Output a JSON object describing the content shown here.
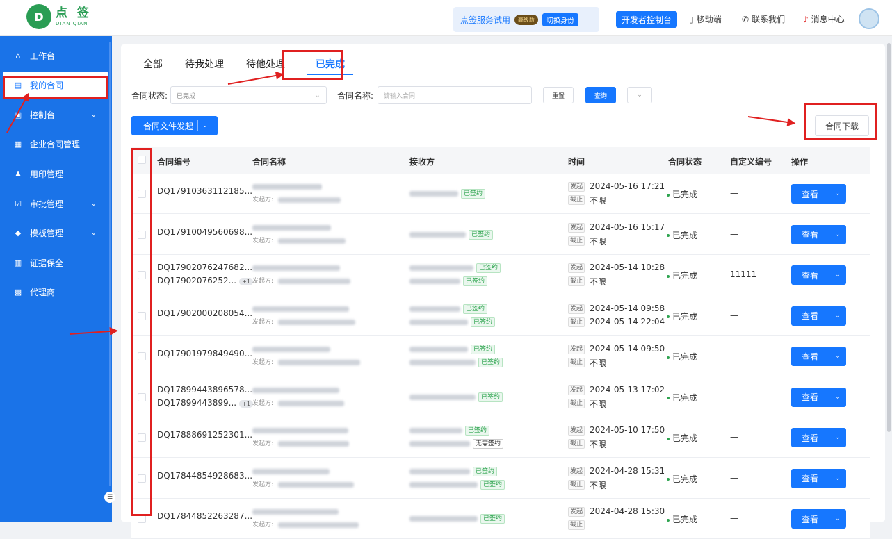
{
  "brand": {
    "cn": "点 签",
    "en": "DIAN QIAN"
  },
  "header": {
    "trial": "点签服务试用",
    "premium": "高级版",
    "switch": "切换身份",
    "dev": "开发者控制台",
    "mobile": "移动端",
    "contact": "联系我们",
    "messages": "消息中心"
  },
  "sidebar": [
    {
      "label": "工作台",
      "icon": "home-icon"
    },
    {
      "label": "我的合同",
      "icon": "contract-icon"
    },
    {
      "label": "控制台",
      "icon": "console-icon",
      "chevron": true
    },
    {
      "label": "企业合同管理",
      "icon": "enterprise-contract-icon"
    },
    {
      "label": "用印管理",
      "icon": "seal-icon"
    },
    {
      "label": "审批管理",
      "icon": "approval-icon",
      "chevron": true
    },
    {
      "label": "模板管理",
      "icon": "template-icon",
      "chevron": true
    },
    {
      "label": "证据保全",
      "icon": "evidence-icon"
    },
    {
      "label": "代理商",
      "icon": "agent-icon"
    }
  ],
  "tabs": [
    "全部",
    "待我处理",
    "待他处理",
    "已完成"
  ],
  "filters": {
    "status_label": "合同状态:",
    "status_value": "已完成",
    "name_label": "合同名称:",
    "name_placeholder": "请输入合同",
    "reset": "重置",
    "query": "查询",
    "expand": "»"
  },
  "actions": {
    "initiate": "合同文件发起",
    "download": "合同下载"
  },
  "table": {
    "headers": [
      "合同编号",
      "合同名称",
      "接收方",
      "时间",
      "合同状态",
      "自定义编号",
      "操作"
    ],
    "start_label": "发起",
    "end_label": "截止",
    "initiator_label": "发起方:",
    "signed": "已签约",
    "nosign": "无需签约",
    "view": "查看",
    "rows": [
      {
        "no": "DQ17910363112185...",
        "start": "2024-05-16 17:21",
        "end": "不限",
        "status": "已完成",
        "custom": "—"
      },
      {
        "no": "DQ17910049560698...",
        "start": "2024-05-16 15:17",
        "end": "不限",
        "status": "已完成",
        "custom": "—"
      },
      {
        "no": "DQ17902076247682...",
        "no2": "DQ17902076252...",
        "plus": "+1",
        "start": "2024-05-14 10:28",
        "end": "不限",
        "status": "已完成",
        "custom": "11111"
      },
      {
        "no": "DQ17902000208054...",
        "start": "2024-05-14 09:58",
        "end": "2024-05-14 22:04",
        "status": "已完成",
        "custom": "—"
      },
      {
        "no": "DQ17901979849490...",
        "start": "2024-05-14 09:50",
        "end": "不限",
        "status": "已完成",
        "custom": "—"
      },
      {
        "no": "DQ17899443896578...",
        "no2": "DQ17899443899...",
        "plus": "+1",
        "start": "2024-05-13 17:02",
        "end": "不限",
        "status": "已完成",
        "custom": "—"
      },
      {
        "no": "DQ17888691252301...",
        "start": "2024-05-10 17:50",
        "end": "不限",
        "status": "已完成",
        "custom": "—"
      },
      {
        "no": "DQ17844854928683...",
        "start": "2024-04-28 15:31",
        "end": "不限",
        "status": "已完成",
        "custom": "—"
      },
      {
        "no": "DQ17844852263287...",
        "start": "2024-04-28 15:30",
        "end": "",
        "status": "已完成",
        "custom": "—"
      }
    ]
  },
  "colors": {
    "primary": "#1677ff",
    "sidebar": "#1a73e8",
    "success": "#2ea44f",
    "annotation": "#e02020"
  }
}
